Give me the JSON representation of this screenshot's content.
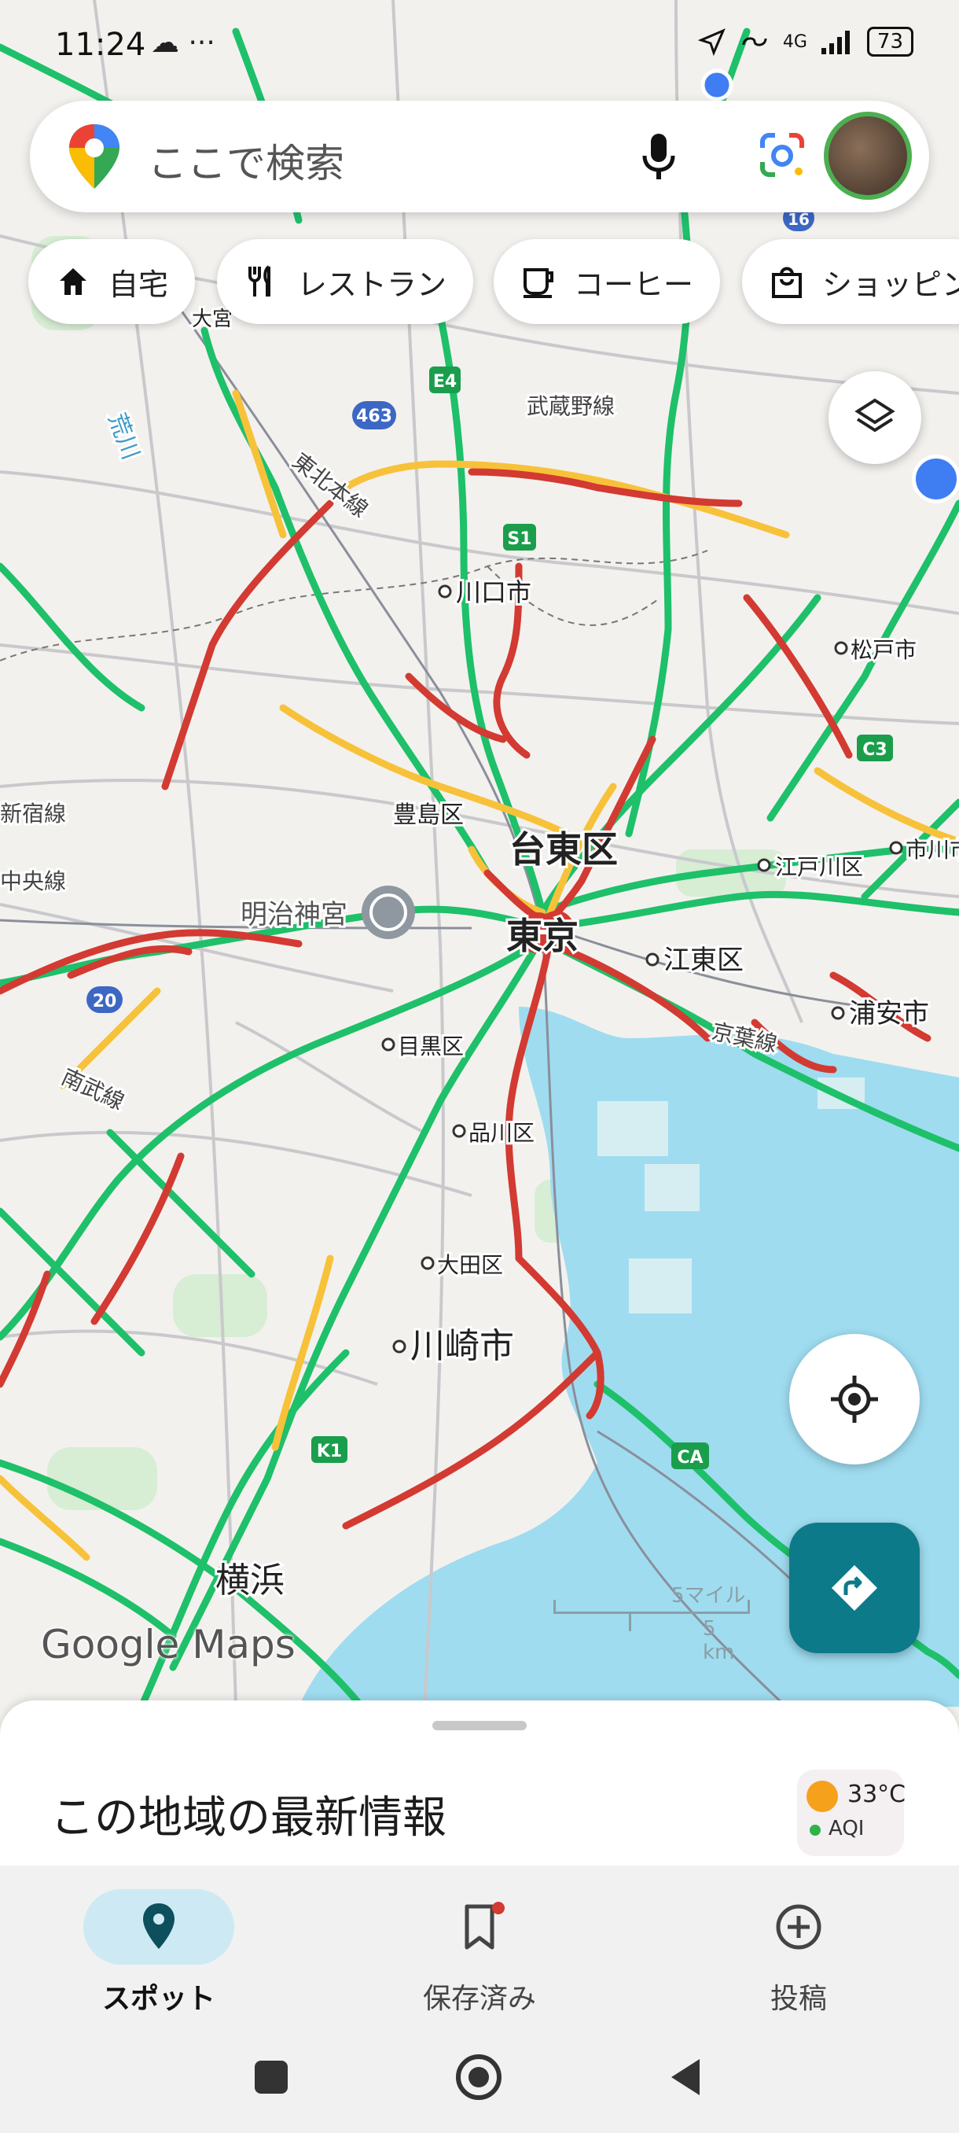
{
  "status_bar": {
    "time": "11:24",
    "left_icons": "☁ ···",
    "network": "4G",
    "battery": "73"
  },
  "search": {
    "placeholder": "ここで検索"
  },
  "chips": [
    {
      "label": "自宅",
      "icon": "home-icon"
    },
    {
      "label": "レストラン",
      "icon": "restaurant-icon"
    },
    {
      "label": "コーヒー",
      "icon": "coffee-icon"
    },
    {
      "label": "ショッピン",
      "icon": "shopping-bag-icon"
    }
  ],
  "map": {
    "labels": {
      "kawaguchi": "川口市",
      "matsudo": "松戸市",
      "taito": "台東区",
      "toshima": "豊島区",
      "meiji": "明治神宮",
      "edogawa": "江戸川区",
      "ichikawa": "市川市",
      "koto": "江東区",
      "urayasu": "浦安市",
      "meguro": "目黒区",
      "shinagawa": "品川区",
      "ota": "大田区",
      "kawasaki": "川崎市",
      "yokohama": "横浜",
      "tokyo": "東京",
      "omiya": "大宮",
      "musashino_line": "武蔵野線",
      "tohoku_line": "東北本線",
      "arakawa": "荒川",
      "shinjuku_line": "新宿線",
      "chuo_line": "中央線",
      "nambu_line": "南武線",
      "keiyo_line": "京葉線",
      "shield_e4": "E4",
      "shield_463": "463",
      "shield_s1": "S1",
      "shield_c3": "C3",
      "shield_20": "20",
      "shield_k1": "K1",
      "shield_ca": "CA",
      "shield_16": "16"
    },
    "scale_miles": "5マイル",
    "scale_km": "5 km",
    "logo": "Google Maps"
  },
  "sheet": {
    "title": "この地域の最新情報",
    "temperature": "33°C",
    "aqi": "AQI"
  },
  "nav": [
    {
      "label": "スポット",
      "icon": "location-pin-icon",
      "active": true
    },
    {
      "label": "保存済み",
      "icon": "bookmark-icon",
      "active": false
    },
    {
      "label": "投稿",
      "icon": "add-circle-icon",
      "active": false
    }
  ],
  "colors": {
    "traffic_green": "#1ec06a",
    "traffic_yellow": "#f7c23a",
    "traffic_red": "#d23a32",
    "water": "#9fdcf0",
    "accent": "#0d7a8a"
  }
}
